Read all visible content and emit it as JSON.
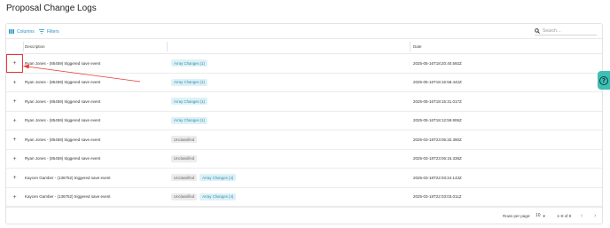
{
  "page": {
    "title": "Proposal Change Logs"
  },
  "toolbar": {
    "columns_label": "Columns",
    "filters_label": "Filters",
    "search_placeholder": "Search…"
  },
  "table": {
    "headers": {
      "description": "Description",
      "tags": "",
      "date": "Date"
    },
    "rows": [
      {
        "description": "Ryan Jones - (85459) triggered save event",
        "chips": [
          {
            "label": "Array Changes (1)",
            "kind": "array"
          }
        ],
        "date": "2025-05-16T18:20:40.592Z"
      },
      {
        "description": "Ryan Jones - (85459) triggered save event",
        "chips": [
          {
            "label": "Array Changes (1)",
            "kind": "array"
          }
        ],
        "date": "2025-05-16T18:16:58.442Z"
      },
      {
        "description": "Ryan Jones - (85459) triggered save event",
        "chips": [
          {
            "label": "Array Changes (1)",
            "kind": "array"
          }
        ],
        "date": "2025-05-16T18:15:31.017Z"
      },
      {
        "description": "Ryan Jones - (85459) triggered save event",
        "chips": [
          {
            "label": "Array Changes (1)",
            "kind": "array"
          }
        ],
        "date": "2025-05-16T18:12:59.906Z"
      },
      {
        "description": "Ryan Jones - (85459) triggered save event",
        "chips": [
          {
            "label": "Unclassified",
            "kind": "uncl"
          }
        ],
        "date": "2025-03-18T23:06:32.390Z"
      },
      {
        "description": "Ryan Jones - (85459) triggered save event",
        "chips": [
          {
            "label": "Unclassified",
            "kind": "uncl"
          }
        ],
        "date": "2025-03-18T23:06:15.338Z"
      },
      {
        "description": "Kaycen Gamber - (136752) triggered save event",
        "chips": [
          {
            "label": "Unclassified",
            "kind": "uncl"
          },
          {
            "label": "Array Changes (4)",
            "kind": "array"
          }
        ],
        "date": "2025-03-18T22:03:24.143Z"
      },
      {
        "description": "Kaycen Gamber - (136752) triggered save event",
        "chips": [
          {
            "label": "Unclassified",
            "kind": "uncl"
          },
          {
            "label": "Array Changes (4)",
            "kind": "array"
          }
        ],
        "date": "2025-03-18T22:03:03.011Z"
      }
    ]
  },
  "footer": {
    "rows_per_page_label": "Rows per page:",
    "rows_per_page_value": "10",
    "range_label": "1–8 of 8"
  },
  "icons": {
    "columns": "columns-icon",
    "filters": "filter-icon",
    "search": "search-icon",
    "expand": "plus-icon",
    "prev": "chevron-left-icon",
    "next": "chevron-right-icon",
    "dropdown": "caret-down-icon",
    "help": "help-icon"
  },
  "colors": {
    "accent": "#2a93c9",
    "chip_array_bg": "#dff1f6",
    "chip_uncl_bg": "#ececec",
    "annotation": "#e53935",
    "help_tab": "#3fbfb3"
  }
}
